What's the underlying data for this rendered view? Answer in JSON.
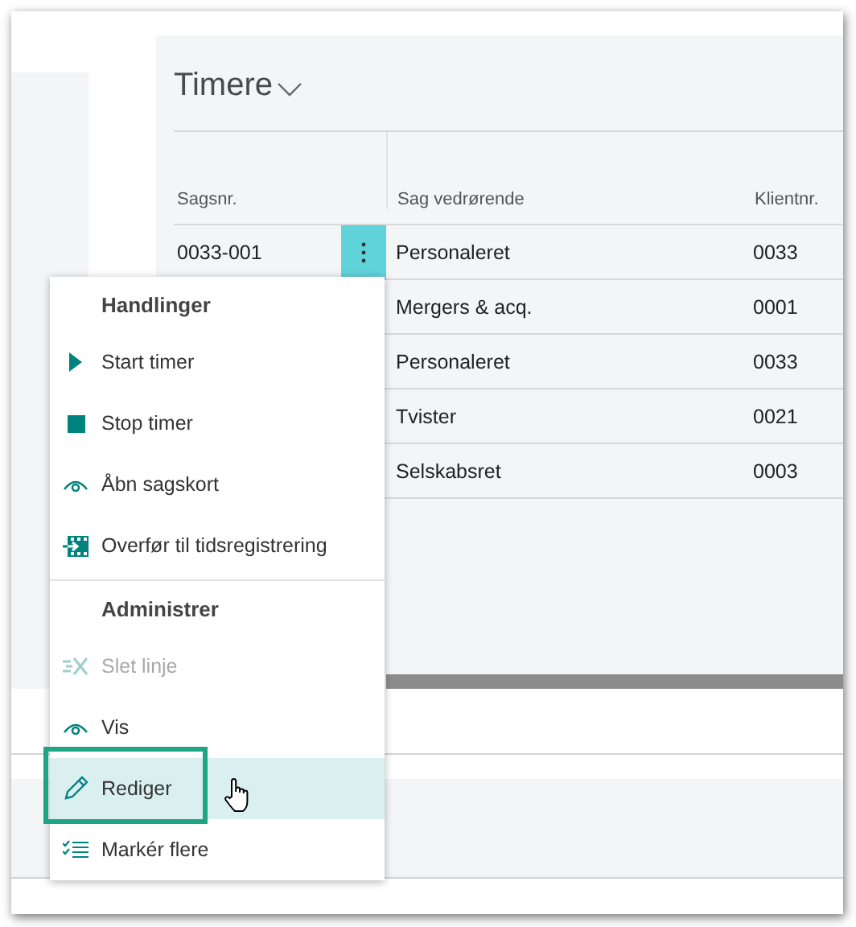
{
  "card": {
    "title": "Timere"
  },
  "table": {
    "columns": [
      "Sagsnr.",
      "Sag vedrørende",
      "Klientnr."
    ],
    "rows": [
      {
        "case_no": "0033-001",
        "matter": "Personaleret",
        "client": "0033",
        "selected": true
      },
      {
        "matter": "Mergers & acq.",
        "client": "0001",
        "selected": false
      },
      {
        "matter": "Personaleret",
        "client": "0033",
        "selected": false
      },
      {
        "matter": "Tvister",
        "client": "0021",
        "selected": false
      },
      {
        "matter": "Selskabsret",
        "client": "0003",
        "selected": false
      }
    ]
  },
  "menu": {
    "groups": [
      {
        "header": "Handlinger",
        "items": [
          {
            "label": "Start timer",
            "disabled": false,
            "selected": false,
            "callout": false
          },
          {
            "label": "Stop timer",
            "disabled": false,
            "selected": false,
            "callout": false
          },
          {
            "label": "Åbn sagskort",
            "disabled": false,
            "selected": false,
            "callout": false
          },
          {
            "label": "Overfør til tidsregistrering",
            "disabled": false,
            "selected": false,
            "callout": false
          }
        ]
      },
      {
        "header": "Administrer",
        "items": [
          {
            "label": "Slet linje",
            "disabled": true,
            "selected": false,
            "callout": false
          },
          {
            "label": "Vis",
            "disabled": false,
            "selected": false,
            "callout": false
          },
          {
            "label": "Rediger",
            "disabled": false,
            "selected": true,
            "callout": true
          },
          {
            "label": "Markér flere",
            "disabled": false,
            "selected": false,
            "callout": false
          }
        ]
      }
    ]
  }
}
